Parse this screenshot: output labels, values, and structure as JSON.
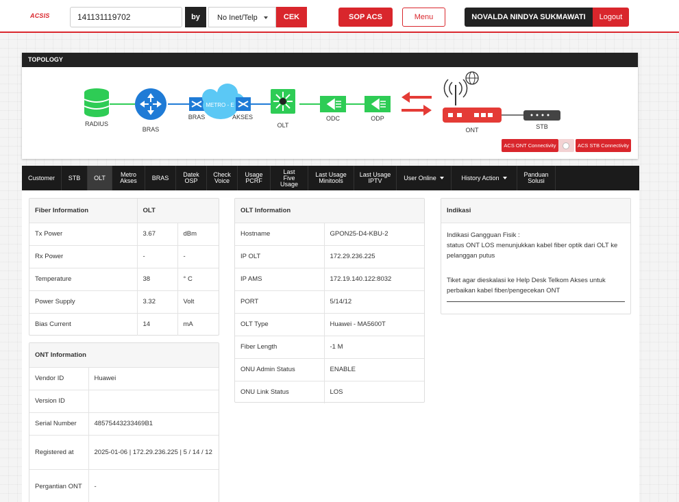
{
  "header": {
    "logo": "ACSIS",
    "search_value": "141131119702",
    "by_label": "by",
    "search_type": "No Inet/Telp",
    "cek_label": "CEK",
    "sop_label": "SOP ACS",
    "menu_label": "Menu",
    "user_name": "NOVALDA NINDYA SUKMAWATI",
    "logout_label": "Logout"
  },
  "topology": {
    "title": "TOPOLOGY",
    "nodes": {
      "radius": "RADIUS",
      "bras": "BRAS",
      "bras2": "BRAS",
      "metro": "METRO - E",
      "akses": "AKSES",
      "olt": "OLT",
      "odc": "ODC",
      "odp": "ODP",
      "ont": "ONT",
      "stb": "STB"
    },
    "acs_ont": "ACS ONT Connectivity",
    "acs_stb": "ACS STB Connectivity",
    "colors": {
      "accent": "#d9262c",
      "green": "#2ecc55",
      "blue": "#1f7bd6",
      "cloud": "#5bc8f5"
    }
  },
  "nav": {
    "items": [
      {
        "label": "Customer"
      },
      {
        "label": "STB"
      },
      {
        "label": "OLT"
      },
      {
        "label": "Metro Akses"
      },
      {
        "label": "BRAS"
      },
      {
        "label": "Datek OSP"
      },
      {
        "label": "Check Voice"
      },
      {
        "label": "Usage PCRF"
      },
      {
        "label": "Last Five Usage"
      },
      {
        "label": "Last Usage Minitools"
      },
      {
        "label": "Last Usage IPTV"
      },
      {
        "label": "User Online"
      },
      {
        "label": "History Action"
      },
      {
        "label": "Panduan Solusi"
      }
    ]
  },
  "fiber": {
    "title": "Fiber Information",
    "col2": "OLT",
    "rows": [
      {
        "label": "Tx Power",
        "value": "3.67",
        "unit": "dBm"
      },
      {
        "label": "Rx Power",
        "value": "-",
        "unit": "-"
      },
      {
        "label": "Temperature",
        "value": "38",
        "unit": "° C"
      },
      {
        "label": "Power Supply",
        "value": "3.32",
        "unit": "Volt"
      },
      {
        "label": "Bias Current",
        "value": "14",
        "unit": "mA"
      }
    ]
  },
  "ont": {
    "title": "ONT Information",
    "rows": [
      {
        "label": "Vendor ID",
        "value": "Huawei"
      },
      {
        "label": "Version ID",
        "value": ""
      },
      {
        "label": "Serial Number",
        "value": "48575443233469B1"
      },
      {
        "label": "Registered at",
        "value": "2025-01-06 | 172.29.236.225 | 5 / 14 / 12"
      },
      {
        "label": "Pergantian ONT",
        "value": "-"
      }
    ]
  },
  "olt": {
    "title": "OLT Information",
    "rows": [
      {
        "label": "Hostname",
        "value": "GPON25-D4-KBU-2"
      },
      {
        "label": "IP OLT",
        "value": "172.29.236.225"
      },
      {
        "label": "IP AMS",
        "value": "172.19.140.122:8032"
      },
      {
        "label": "PORT",
        "value": "5/14/12"
      },
      {
        "label": "OLT Type",
        "value": "Huawei - MA5600T"
      },
      {
        "label": "Fiber Length",
        "value": "-1 M"
      },
      {
        "label": "ONU Admin Status",
        "value": "ENABLE"
      },
      {
        "label": "ONU Link Status",
        "value": "LOS"
      }
    ]
  },
  "indikasi": {
    "title": "Indikasi",
    "line1": "Indikasi Gangguan Fisik :",
    "line2": "status ONT LOS menunjukkan kabel fiber optik dari OLT ke pelanggan putus",
    "line3": "Tiket agar dieskalasi ke Help Desk Telkom Akses untuk perbaikan kabel fiber/pengecekan ONT"
  }
}
